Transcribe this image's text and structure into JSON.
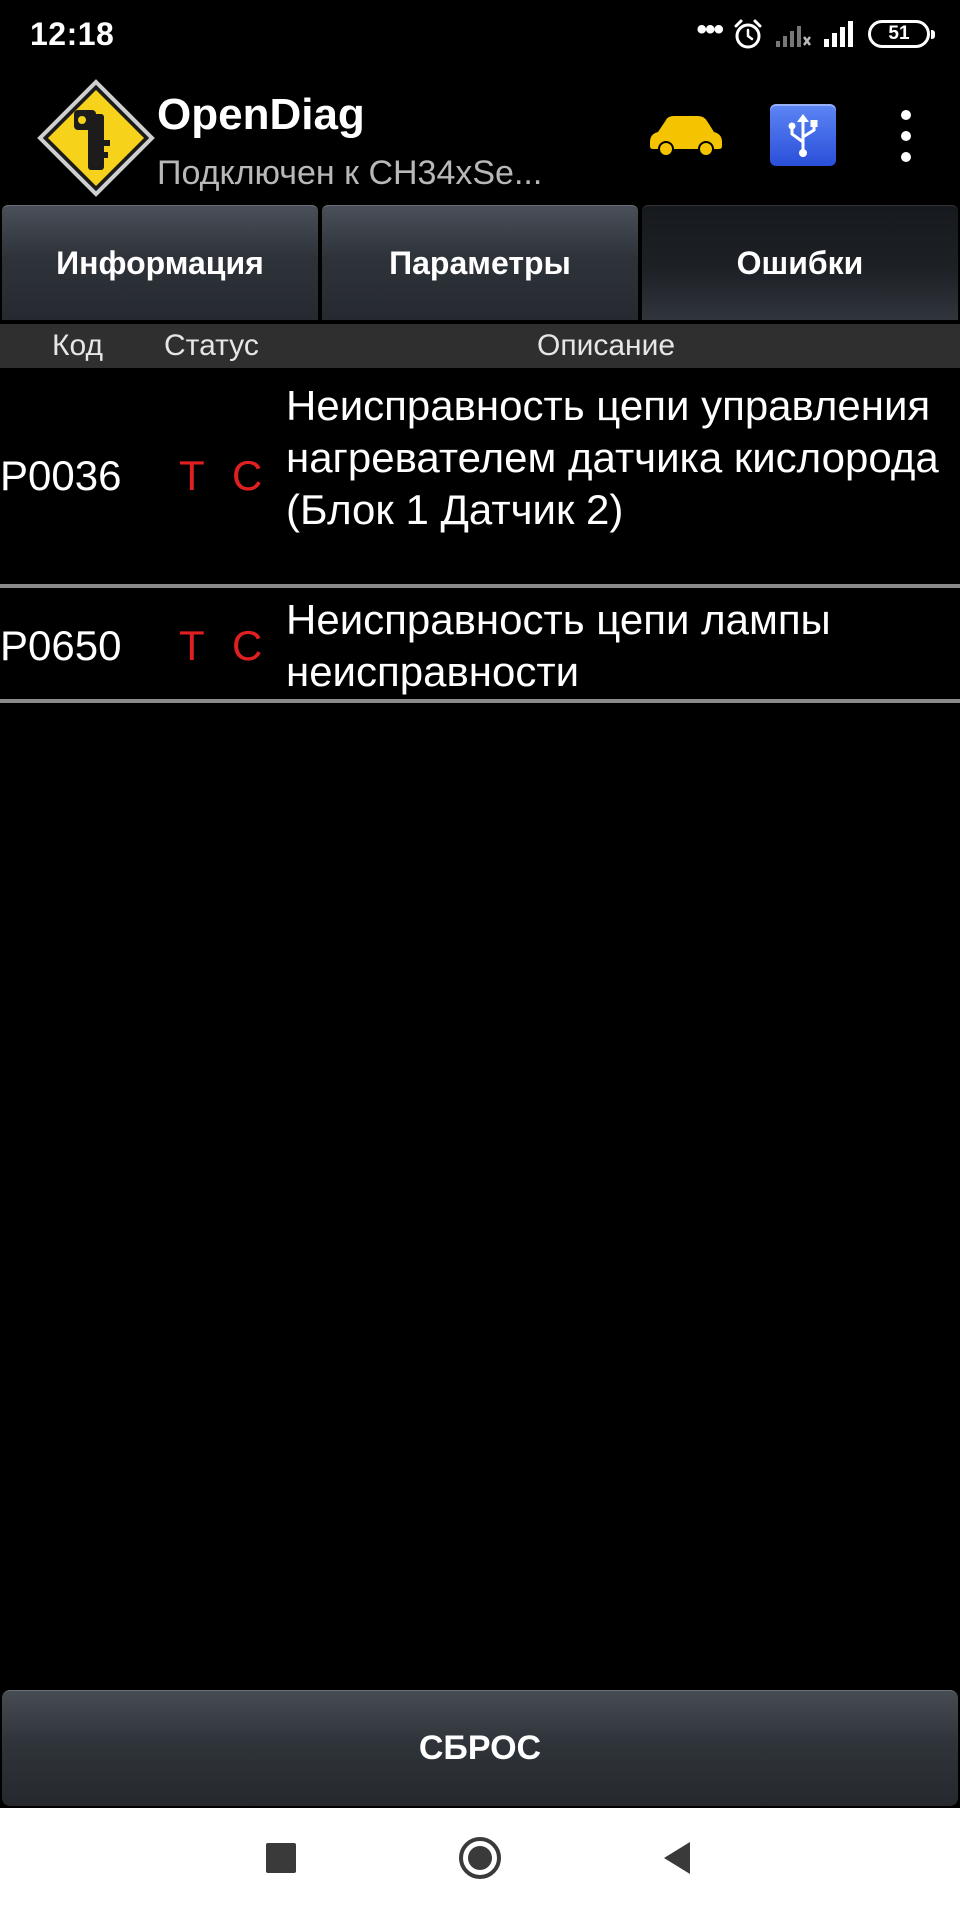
{
  "status_bar": {
    "time": "12:18",
    "dots": "•••",
    "battery": "51",
    "icons": [
      "alarm-icon",
      "signal-no-data-icon",
      "signal-icon",
      "battery-icon"
    ]
  },
  "app_bar": {
    "title": "OpenDiag",
    "subtitle": "Подключен к CH34xSe...",
    "icons": [
      "app-logo-icon",
      "car-icon",
      "usb-icon",
      "more-vert-icon"
    ],
    "colors": {
      "car": "#f4c400",
      "usb_button": "#3a63e8",
      "logo_yellow": "#f7d21a"
    }
  },
  "tabs": [
    {
      "label": "Информация",
      "active": false
    },
    {
      "label": "Параметры",
      "active": false
    },
    {
      "label": "Ошибки",
      "active": true
    }
  ],
  "table": {
    "headers": {
      "code": "Код",
      "status": "Статус",
      "description": "Описание"
    },
    "rows": [
      {
        "code": "P0036",
        "status_t": "T",
        "status_c": "C",
        "description": "Неисправность цепи управления нагревателем датчика кислорода (Блок 1 Датчик 2)"
      },
      {
        "code": "P0650",
        "status_t": "T",
        "status_c": "C",
        "description": "Неисправность цепи лампы неисправности"
      }
    ],
    "colors": {
      "status": "#e02020",
      "header_bg": "#2f2f2f"
    }
  },
  "reset_button": {
    "label": "СБРОС"
  },
  "nav_bar": {
    "icons": [
      "recents-icon",
      "home-icon",
      "back-icon"
    ]
  }
}
